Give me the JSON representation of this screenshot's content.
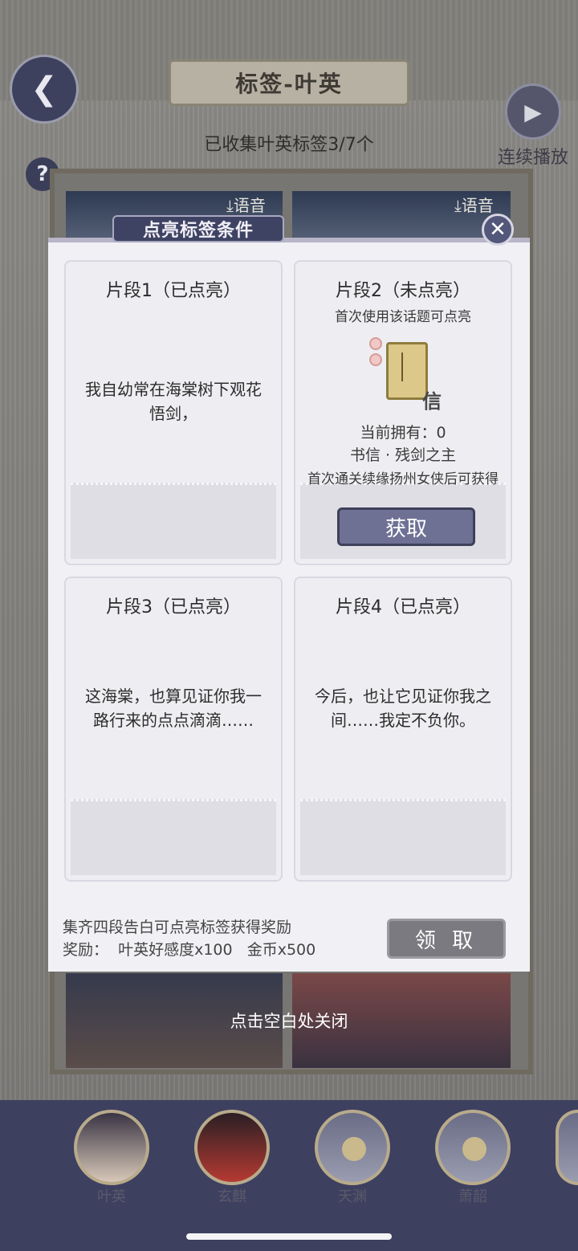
{
  "header": {
    "title": "标签-叶英",
    "autoplay_label": "连续播放",
    "collect_status": "已收集叶英标签3/7个"
  },
  "background": {
    "voice_label_1": "语音",
    "voice_label_2": "语音"
  },
  "modal": {
    "title": "点亮标签条件",
    "cards": [
      {
        "heading": "片段1（已点亮）",
        "text": "我自幼常在海棠树下观花悟剑，"
      },
      {
        "heading": "片段2（未点亮）",
        "hint": "首次使用该话题可点亮",
        "item_char": "信",
        "owned": "当前拥有：0",
        "item_name": "书信 · 残剑之主",
        "source": "首次通关续缘扬州女侠后可获得",
        "button": "获取"
      },
      {
        "heading": "片段3（已点亮）",
        "text": "这海棠，也算见证你我一路行来的点点滴滴……"
      },
      {
        "heading": "片段4（已点亮）",
        "text": "今后，也让它见证你我之间……我定不负你。"
      }
    ],
    "reward_hint": "集齐四段告白可点亮标签获得奖励",
    "reward_line": "奖励：  叶英好感度x100   金币x500",
    "claim_button": "领 取"
  },
  "close_hint": "点击空白处关闭",
  "characters": [
    {
      "name": "叶英"
    },
    {
      "name": "玄麒"
    },
    {
      "name": "天渊"
    },
    {
      "name": "萧韶"
    }
  ]
}
